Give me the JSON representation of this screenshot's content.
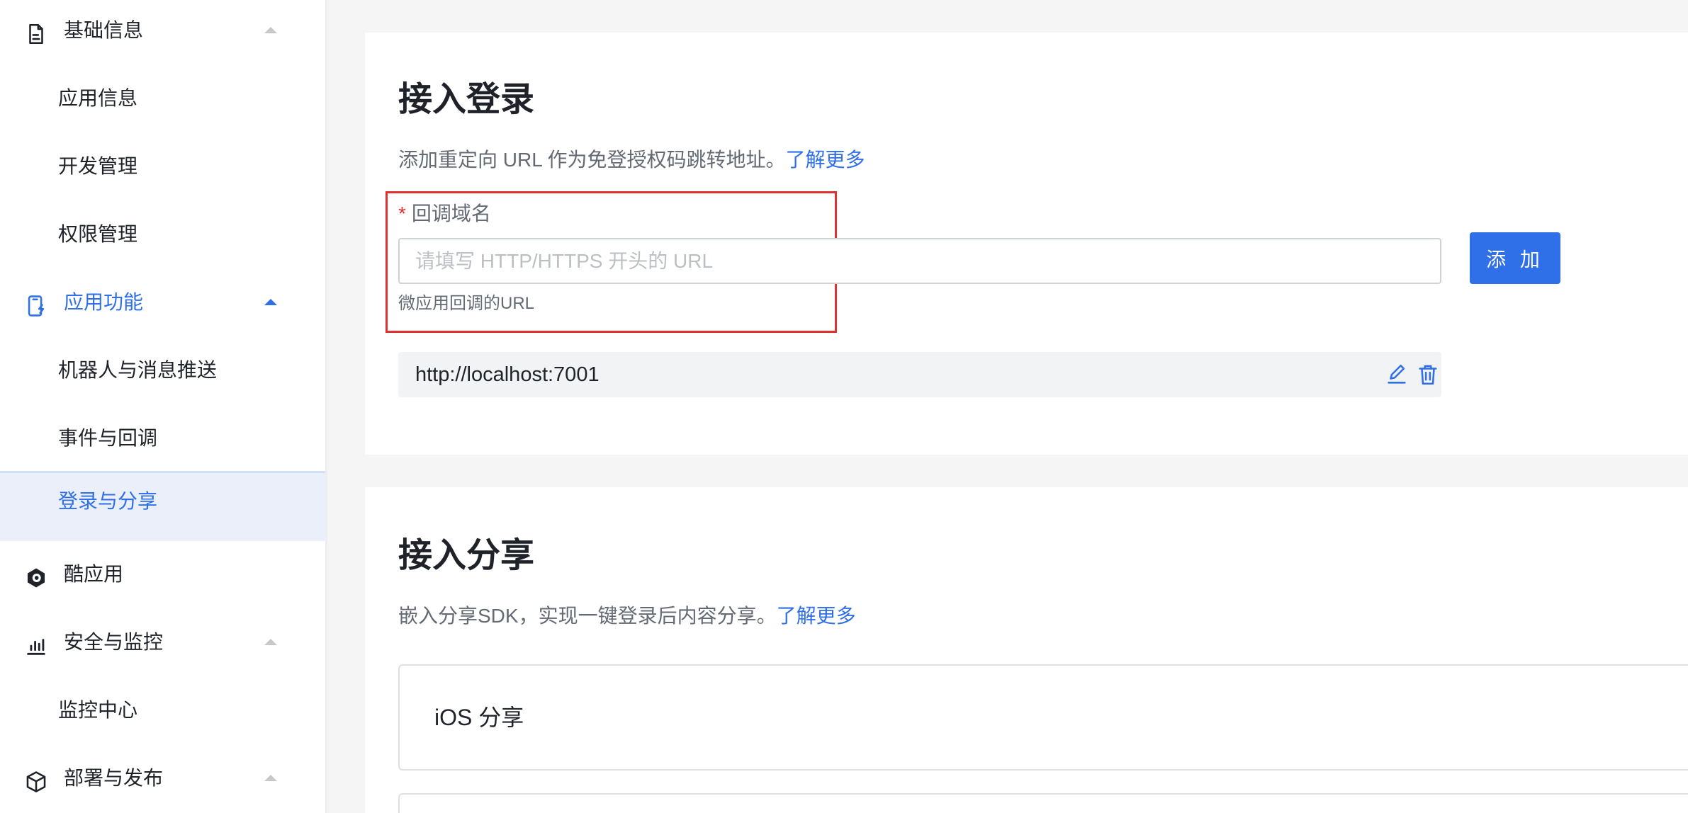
{
  "sidebar": {
    "groups": {
      "basic_info": {
        "label": "基础信息",
        "icon": "document-icon"
      },
      "app_features": {
        "label": "应用功能",
        "icon": "phone-icon"
      },
      "cool_app": {
        "label": "酷应用",
        "icon": "cool-app-icon"
      },
      "security": {
        "label": "安全与监控",
        "icon": "bar-chart-icon"
      },
      "deploy": {
        "label": "部署与发布",
        "icon": "box-icon"
      }
    },
    "items": {
      "app_info": "应用信息",
      "dev_manage": "开发管理",
      "permission_manage": "权限管理",
      "robot_push": "机器人与消息推送",
      "event_callback": "事件与回调",
      "login_share": "登录与分享",
      "monitor_center": "监控中心"
    }
  },
  "login_section": {
    "title": "接入登录",
    "description": "添加重定向 URL 作为免登授权码跳转地址。",
    "learn_more": "了解更多",
    "field_required_mark": "*",
    "field_label": "回调域名",
    "input_placeholder": "请填写 HTTP/HTTPS 开头的 URL",
    "input_value": "",
    "help_text": "微应用回调的URL",
    "add_button": "添 加",
    "urls": [
      "http://localhost:7001"
    ],
    "edit_icon": "edit-icon",
    "delete_icon": "trash-icon"
  },
  "share_section": {
    "title": "接入分享",
    "description": "嵌入分享SDK，实现一键登录后内容分享。",
    "learn_more": "了解更多",
    "ios_card_title": "iOS 分享"
  },
  "colors": {
    "accent": "#2f6fe8",
    "required": "#e03131",
    "highlight_border": "#e03131",
    "selected_bg": "#eaeff9"
  }
}
